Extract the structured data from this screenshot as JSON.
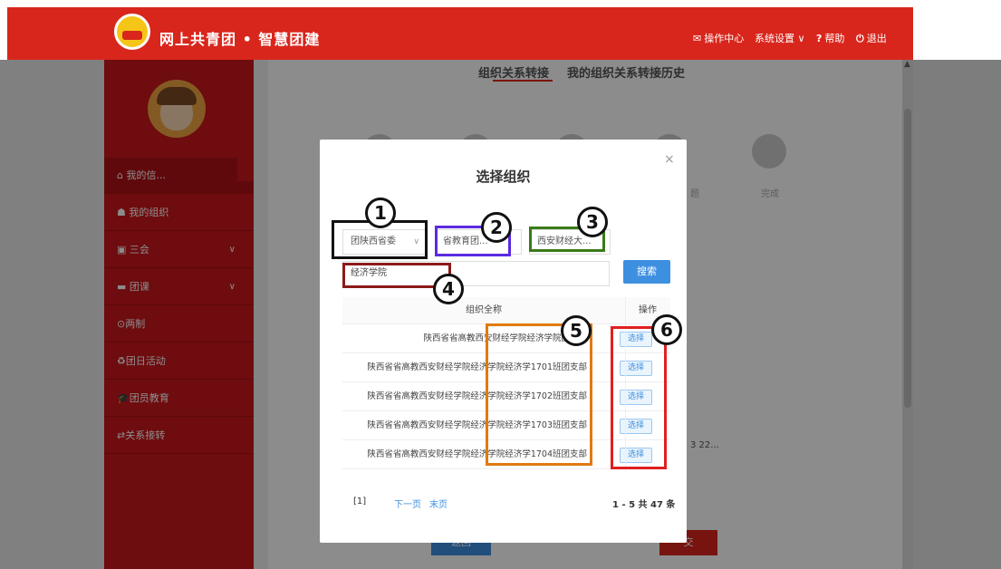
{
  "app": {
    "brand": "网上共青团 • 智慧团建",
    "topnav": {
      "ops_center": "操作中心",
      "settings": "系统设置",
      "help": "帮助",
      "logout": "退出"
    }
  },
  "sidebar": {
    "items": [
      {
        "label": "我的信..."
      },
      {
        "label": "我的组织"
      },
      {
        "label": "三会"
      },
      {
        "label": "团课"
      },
      {
        "label": "两制"
      },
      {
        "label": "团日活动"
      },
      {
        "label": "团员教育"
      },
      {
        "label": "关系接转"
      }
    ]
  },
  "page": {
    "tabs": [
      {
        "label": "组织关系转接"
      },
      {
        "label": "我的组织关系转接历史"
      }
    ],
    "step_done_label": "完成",
    "step_partial_label": "题",
    "partial_date": "3 22...",
    "submit_partial": "交",
    "back_partial": "返回"
  },
  "modal": {
    "title": "选择组织",
    "close": "×",
    "selects": {
      "province": "团陕西省委",
      "education": "省教育团...",
      "university": "西安财经大..."
    },
    "search": {
      "value": "经济学院",
      "button": "搜索"
    },
    "table": {
      "headers": {
        "org": "组织全称",
        "action": "操作"
      },
      "rows": [
        {
          "org": "陕西省省高教西安财经学院经济学院团工委",
          "action": "选择"
        },
        {
          "org": "陕西省省高教西安财经学院经济学院经济学1701班团支部",
          "action": "选择"
        },
        {
          "org": "陕西省省高教西安财经学院经济学院经济学1702班团支部",
          "action": "选择"
        },
        {
          "org": "陕西省省高教西安财经学院经济学院经济学1703班团支部",
          "action": "选择"
        },
        {
          "org": "陕西省省高教西安财经学院经济学院经济学1704班团支部",
          "action": "选择"
        }
      ]
    },
    "pager": {
      "current": "[1]",
      "next": "下一页",
      "last": "末页",
      "summary": "1 - 5  共 47 条"
    }
  },
  "annotations": [
    {
      "number": "1",
      "color": "#111111"
    },
    {
      "number": "2",
      "color": "#5b2be0"
    },
    {
      "number": "3",
      "color": "#3a7a1a"
    },
    {
      "number": "4",
      "color": "#8b1a1a"
    },
    {
      "number": "5",
      "color": "#e07a10"
    },
    {
      "number": "6",
      "color": "#e02020"
    }
  ],
  "colors": {
    "brand_red": "#d9261c",
    "sidebar_red": "#c8171c",
    "primary_blue": "#3d8fe0"
  }
}
